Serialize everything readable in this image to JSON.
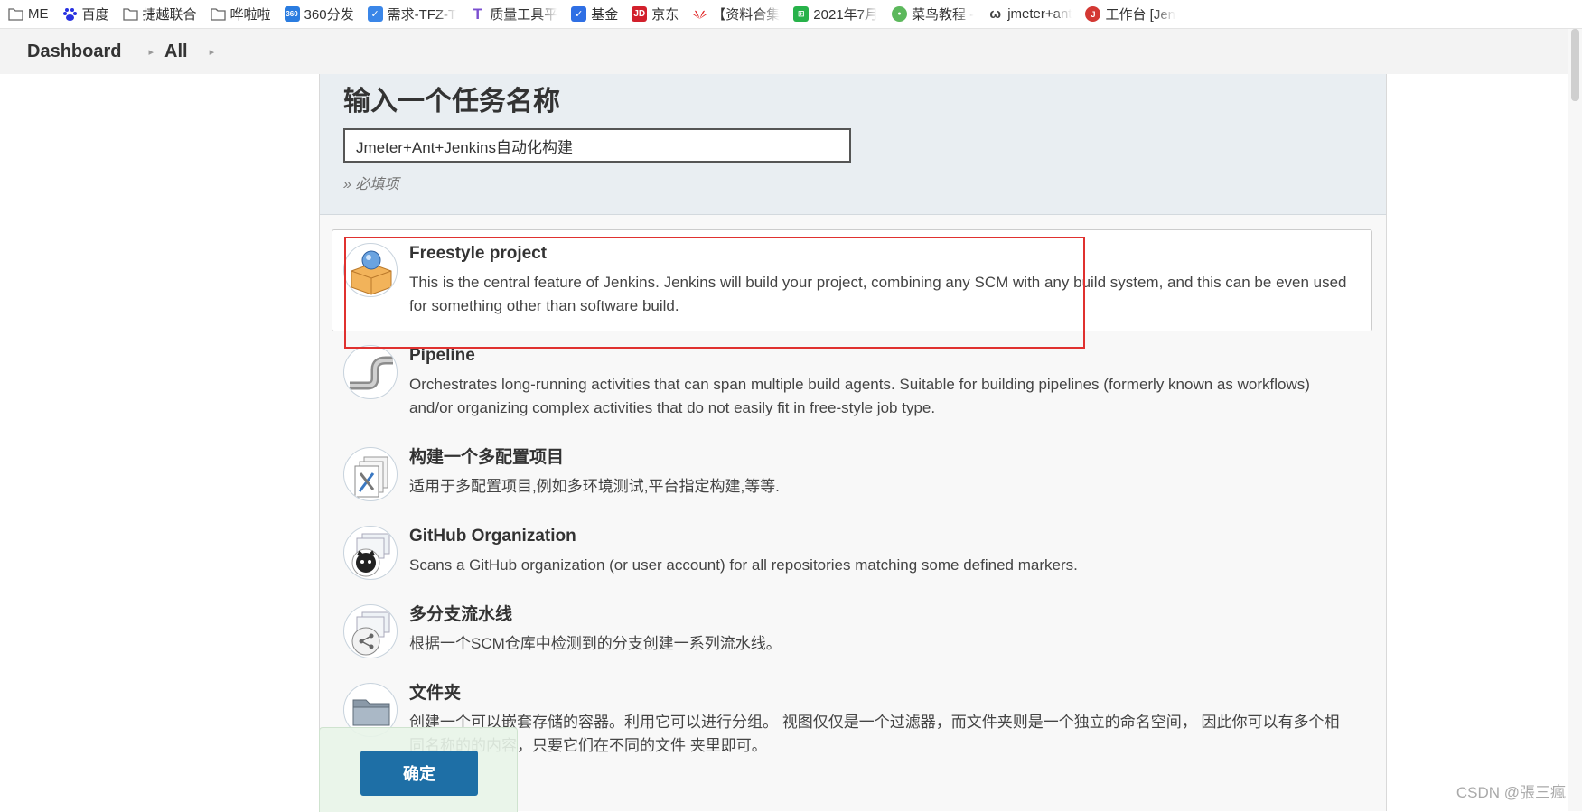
{
  "bookmarks": [
    {
      "label": "ME",
      "icon": "folder-icon"
    },
    {
      "label": "百度",
      "icon": "baidu-icon"
    },
    {
      "label": "捷越联合",
      "icon": "folder-icon"
    },
    {
      "label": "哗啦啦",
      "icon": "folder-icon"
    },
    {
      "label": "360分发",
      "icon": "360-icon"
    },
    {
      "label": "需求-TFZ-T",
      "icon": "tapd-icon"
    },
    {
      "label": "质量工具平",
      "icon": "t-icon"
    },
    {
      "label": "基金",
      "icon": "check-icon"
    },
    {
      "label": "京东",
      "icon": "jd-icon"
    },
    {
      "label": "【资料合集",
      "icon": "huawei-icon"
    },
    {
      "label": "2021年7月",
      "icon": "sheet-icon"
    },
    {
      "label": "菜鸟教程 -",
      "icon": "runoob-icon"
    },
    {
      "label": "jmeter+ant",
      "icon": "omega-icon"
    },
    {
      "label": "工作台 [Jen",
      "icon": "jenkins-icon"
    }
  ],
  "breadcrumb": {
    "items": [
      "Dashboard",
      "All"
    ]
  },
  "form": {
    "title": "输入一个任务名称",
    "name_value": "Jmeter+Ant+Jenkins自动化构建",
    "required_note": "» 必填项"
  },
  "job_types": [
    {
      "name": "Freestyle project",
      "desc": "This is the central feature of Jenkins. Jenkins will build your project, combining any SCM with any build system, and this can be even used for something other than software build.",
      "icon": "freestyle-project-icon",
      "selected": true
    },
    {
      "name": "Pipeline",
      "desc": "Orchestrates long-running activities that can span multiple build agents. Suitable for building pipelines (formerly known as workflows) and/or organizing complex activities that do not easily fit in free-style job type.",
      "icon": "pipeline-icon",
      "selected": false
    },
    {
      "name": "构建一个多配置项目",
      "desc": "适用于多配置项目,例如多环境测试,平台指定构建,等等.",
      "icon": "multi-config-icon",
      "selected": false
    },
    {
      "name": "GitHub Organization",
      "desc": "Scans a GitHub organization (or user account) for all repositories matching some defined markers.",
      "icon": "github-icon",
      "selected": false
    },
    {
      "name": "多分支流水线",
      "desc": "根据一个SCM仓库中检测到的分支创建一系列流水线。",
      "icon": "multibranch-icon",
      "selected": false
    },
    {
      "name": "文件夹",
      "desc": "创建一个可以嵌套存储的容器。利用它可以进行分组。 视图仅仅是一个过滤器，而文件夹则是一个独立的命名空间， 因此你可以有多个相同名称的的内容，只要它们在不同的文件 夹里即可。",
      "icon": "folder-icon",
      "selected": false
    }
  ],
  "ok_button": "确定",
  "watermark": "CSDN @張三瘋",
  "colors": {
    "highlight": "#e0312f",
    "ok_button": "#1e6fa6",
    "header_bg": "#e9eef2"
  }
}
